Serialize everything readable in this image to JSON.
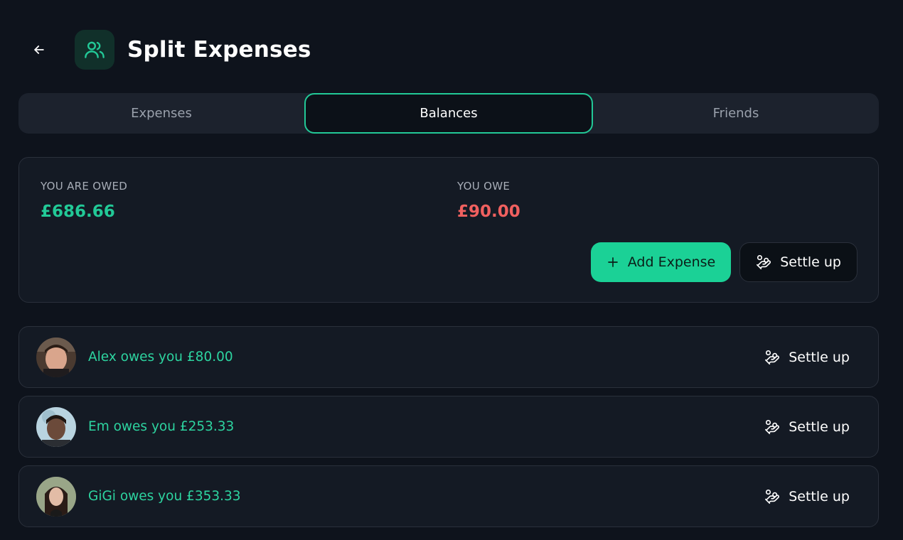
{
  "header": {
    "back_icon": "arrow-left-icon",
    "app_icon": "users-icon",
    "title": "Split Expenses"
  },
  "tabs": [
    {
      "label": "Expenses",
      "active": false
    },
    {
      "label": "Balances",
      "active": true
    },
    {
      "label": "Friends",
      "active": false
    }
  ],
  "summary": {
    "owed_label": "YOU ARE OWED",
    "owed_value": "£686.66",
    "owe_label": "YOU OWE",
    "owe_value": "£90.00",
    "add_expense_label": "Add Expense",
    "settle_up_label": "Settle up"
  },
  "balances": [
    {
      "name": "Alex",
      "text": "Alex owes you £80.00",
      "settle_label": "Settle up"
    },
    {
      "name": "Em",
      "text": "Em owes you £253.33",
      "settle_label": "Settle up"
    },
    {
      "name": "GiGi",
      "text": "GiGi owes you £353.33",
      "settle_label": "Settle up"
    }
  ],
  "colors": {
    "background": "#0e131c",
    "accent": "#22c997",
    "owed": "#22c997",
    "owe": "#f0605f",
    "card": "#141a24"
  }
}
